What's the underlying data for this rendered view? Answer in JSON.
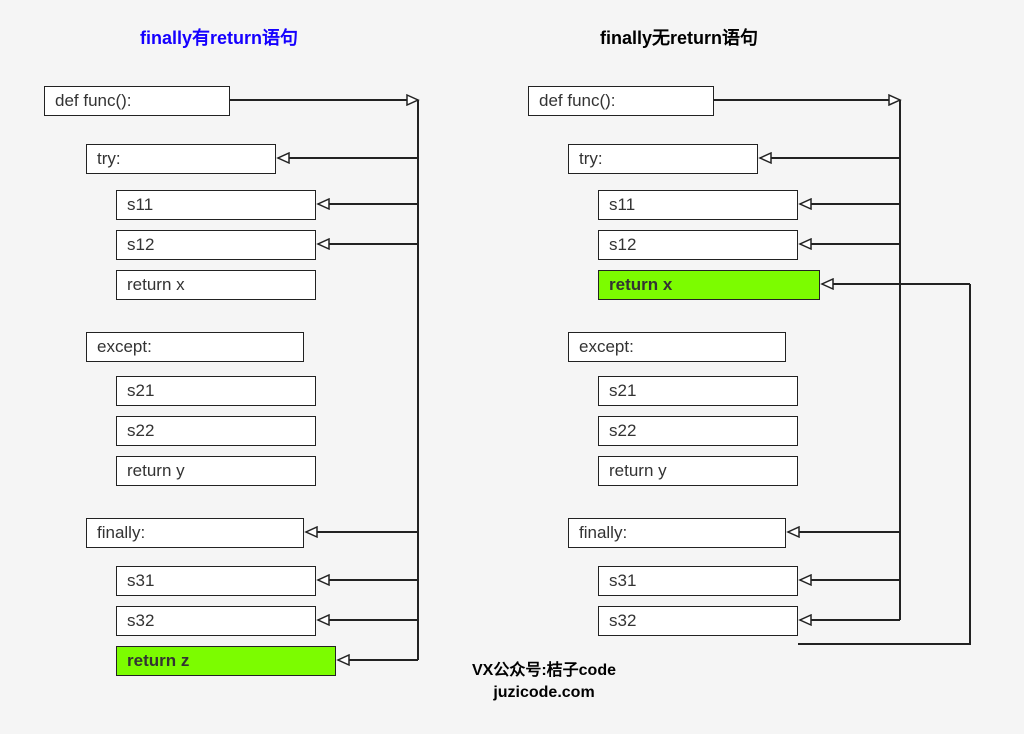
{
  "left": {
    "title": "finally有return语句",
    "def": "def func():",
    "try": "try:",
    "s11": "s11",
    "s12": "s12",
    "retx": "return x",
    "except": "except:",
    "s21": "s21",
    "s22": "s22",
    "rety": "return y",
    "finally": "finally:",
    "s31": "s31",
    "s32": "s32",
    "retz": "return z"
  },
  "right": {
    "title": "finally无return语句",
    "def": "def func():",
    "try": "try:",
    "s11": "s11",
    "s12": "s12",
    "retx": "return x",
    "except": "except:",
    "s21": "s21",
    "s22": "s22",
    "rety": "return y",
    "finally": "finally:",
    "s31": "s31",
    "s32": "s32"
  },
  "credit": {
    "line1": "VX公众号:桔子code",
    "line2": "juzicode.com"
  }
}
